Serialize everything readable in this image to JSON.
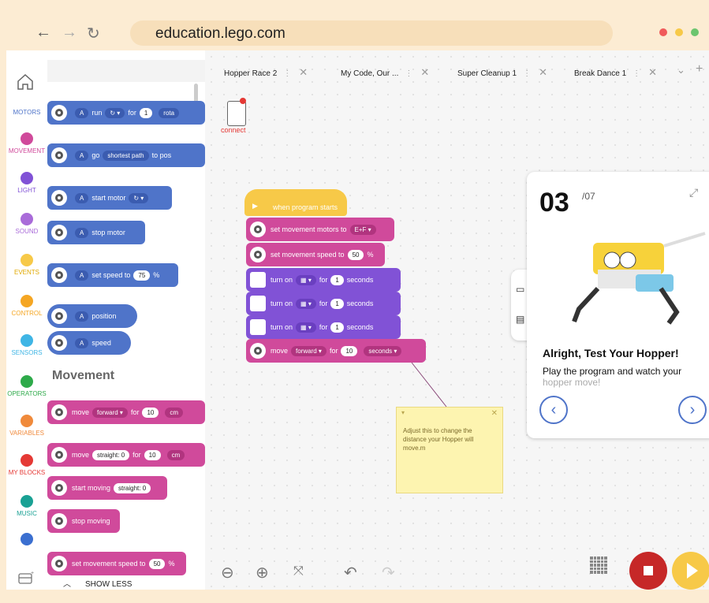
{
  "browser": {
    "url": "education.lego.com",
    "back_icon": "←",
    "forward_icon": "→",
    "reload_icon": "↻",
    "dot_colors": [
      "#f05a5a",
      "#f7c948",
      "#6cc56e"
    ]
  },
  "categories": [
    {
      "label": "MOTORS",
      "color": "#4f74c9"
    },
    {
      "label": "MOVEMENT",
      "color": "#d04a9b"
    },
    {
      "label": "LIGHT",
      "color": "#8152d6"
    },
    {
      "label": "SOUND",
      "color": "#a96bd9"
    },
    {
      "label": "EVENTS",
      "color": "#f7c948"
    },
    {
      "label": "CONTROL",
      "color": "#f5a623"
    },
    {
      "label": "SENSORS",
      "color": "#3fb5e5"
    },
    {
      "label": "OPERATORS",
      "color": "#2eaa4a"
    },
    {
      "label": "VARIABLES",
      "color": "#f08a3b"
    },
    {
      "label": "MY BLOCKS",
      "color": "#e53935"
    },
    {
      "label": "MUSIC",
      "color": "#1aa194"
    }
  ],
  "palette": {
    "b1": {
      "port": "A",
      "run": "run",
      "for": "for",
      "num": "1",
      "unit": "rota"
    },
    "b2": {
      "port": "A",
      "go": "go",
      "opt": "shortest path",
      "to": "to pos"
    },
    "b3": {
      "port": "A",
      "text": "start motor"
    },
    "b4": {
      "port": "A",
      "text": "stop motor"
    },
    "b5": {
      "port": "A",
      "text": "set speed to",
      "num": "75",
      "unit": "%"
    },
    "b6": {
      "port": "A",
      "text": "position"
    },
    "b7": {
      "port": "A",
      "text": "speed"
    },
    "section": "Movement",
    "m1": {
      "text": "move",
      "dir": "forward",
      "for": "for",
      "num": "10",
      "unit": "cm"
    },
    "m2": {
      "text": "move",
      "dir": "straight: 0",
      "for": "for",
      "num": "10",
      "unit": "cm"
    },
    "m3": {
      "text": "start moving",
      "dir": "straight: 0"
    },
    "m4": {
      "text": "stop moving"
    },
    "m5": {
      "text": "set movement speed to",
      "num": "50",
      "unit": "%"
    },
    "show_less": "SHOW LESS"
  },
  "tabs": [
    {
      "label": "Hopper Race 2"
    },
    {
      "label": "My Code, Our ..."
    },
    {
      "label": "Super Cleanup 1"
    },
    {
      "label": "Break Dance 1"
    }
  ],
  "canvas": {
    "connect": "connect",
    "program": {
      "hat": "when program starts",
      "b1": {
        "text": "set movement motors to",
        "val": "E+F"
      },
      "b2": {
        "text": "set movement speed to",
        "val": "50",
        "unit": "%"
      },
      "b3": {
        "text": "turn on",
        "for": "for",
        "val": "1",
        "unit": "seconds"
      },
      "b4": {
        "text": "turn on",
        "for": "for",
        "val": "1",
        "unit": "seconds"
      },
      "b5": {
        "text": "turn on",
        "for": "for",
        "val": "1",
        "unit": "seconds"
      },
      "b6": {
        "text": "move",
        "dir": "forward",
        "for": "for",
        "val": "10",
        "unit": "seconds"
      }
    },
    "note": "Adjust this to change the distance your Hopper will move.m"
  },
  "lesson": {
    "step": "03",
    "of": "/07",
    "title": "Alright, Test Your Hopper!",
    "body": "Play the program and watch your",
    "body_faded": "hopper move!",
    "prev": "‹",
    "next": "›"
  }
}
